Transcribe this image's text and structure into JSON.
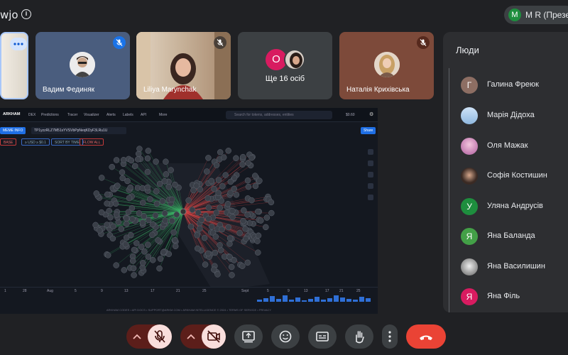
{
  "header": {
    "title_fragment": "wjo",
    "presenter_avatar_initial": "M",
    "presenter_label": "M R (Презен"
  },
  "tiles": [
    {
      "name": "Вадим Фединяк"
    },
    {
      "name": "Liliya Marynchak"
    },
    {
      "label": "Ще 16 осіб",
      "badge_initial": "O"
    },
    {
      "name": "Наталія Крихівська"
    }
  ],
  "shared_screen": {
    "logo": "ARKHAM",
    "nav": [
      "DEX",
      "Predictions",
      "Tracer",
      "Visualizer",
      "Alerts",
      "Labels",
      "API",
      "More"
    ],
    "search_placeholder": "Search for tokens, addresses, entities",
    "price": "$0.60",
    "share_button": "Share",
    "address_chip": "MEME INFO",
    "address": "TP1yzzRLZ7M51sYVSVbPpNeqKDyF3LRu1U",
    "filters": [
      "BASE",
      "≥ USD ≥ $0.1",
      "SORT BY TIME",
      "FLOW ALL"
    ],
    "timeline_labels": [
      "1",
      "28",
      "Aug",
      "5",
      "9",
      "13",
      "17",
      "21",
      "25",
      "Sept",
      "5",
      "9",
      "13",
      "17",
      "21",
      "25"
    ],
    "footer": "ARKHAM CODES • API DOCS • SUPPORT@ARKM.COM • ARKHAM INTELLIGENCE © 2024 • TERMS OF SERVICE • PRIVACY"
  },
  "people_panel": {
    "title": "Люди",
    "people": [
      {
        "initial": "Г",
        "name": "Галина Фреюк",
        "color": "#8d6e63"
      },
      {
        "initial": "",
        "name": "Марія Дідоха",
        "color": "#a8c7e6"
      },
      {
        "initial": "",
        "name": "Оля Мажак",
        "color": "#d48fc4"
      },
      {
        "initial": "",
        "name": "Софія Костишин",
        "color": "#4a3b35"
      },
      {
        "initial": "У",
        "name": "Уляна Андрусів",
        "color": "#1e8e3e"
      },
      {
        "initial": "Я",
        "name": "Яна Баланда",
        "color": "#43a047"
      },
      {
        "initial": "",
        "name": "Яна Василишин",
        "color": "#9e9e9e"
      },
      {
        "initial": "Я",
        "name": "Яна Філь",
        "color": "#d81b60"
      }
    ]
  },
  "colors": {
    "background": "#202124",
    "danger": "#ea4335",
    "muted_red": "#f9dedc",
    "panel": "#2d2e31"
  }
}
